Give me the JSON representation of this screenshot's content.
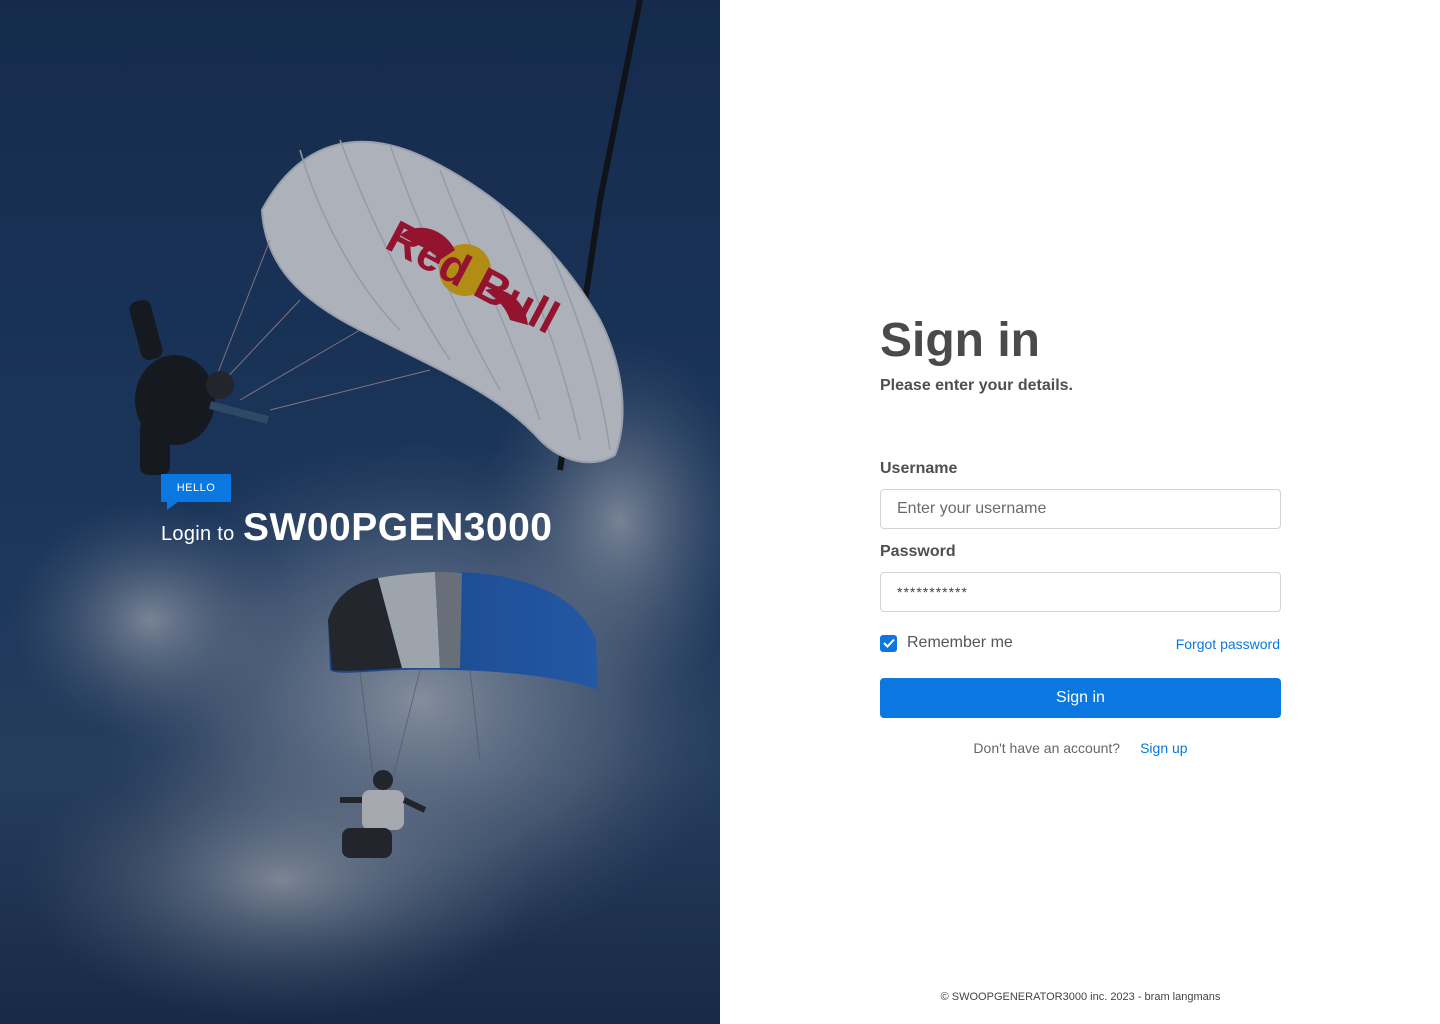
{
  "hero": {
    "badge": "HELLO",
    "login_to": "Login to",
    "brand": "SW00PGEN3000",
    "canopy_logo_text": "Red Bull"
  },
  "form": {
    "title": "Sign in",
    "subtitle": "Please enter your details.",
    "username_label": "Username",
    "username_placeholder": "Enter your username",
    "password_label": "Password",
    "password_value": "***********",
    "remember_label": "Remember me",
    "remember_checked": true,
    "forgot_label": "Forgot password",
    "submit_label": "Sign in",
    "no_account_text": "Don't have an account?",
    "signup_label": "Sign up"
  },
  "footer": {
    "text": "© SWOOPGENERATOR3000 inc. 2023 - bram langmans"
  },
  "colors": {
    "accent": "#0a78e0",
    "hero_overlay": "#1d3a64",
    "text_dark": "#4a4a4a"
  },
  "icons": {
    "checkbox": "check-icon"
  }
}
